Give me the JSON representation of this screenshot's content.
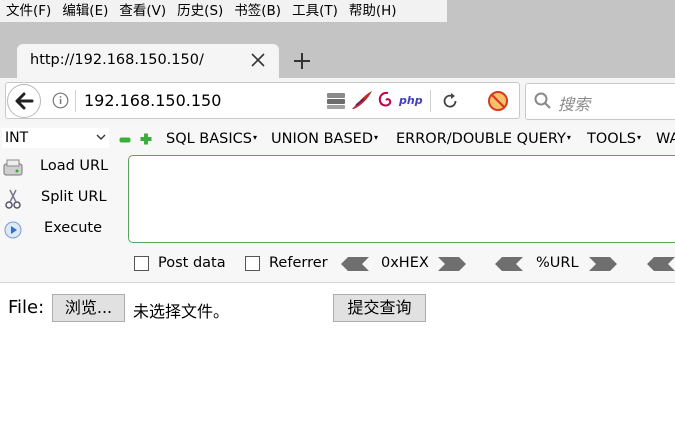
{
  "menubar": {
    "items": [
      "文件(F)",
      "编辑(E)",
      "查看(V)",
      "历史(S)",
      "书签(B)",
      "工具(T)",
      "帮助(H)"
    ]
  },
  "tab": {
    "title": "http://192.168.150.150/"
  },
  "navbar": {
    "url": "192.168.150.150",
    "search_placeholder": "搜索",
    "php_badge": "php"
  },
  "hackbar": {
    "encoding_select": "INT",
    "menus": [
      "SQL BASICS",
      "UNION BASED",
      "ERROR/DOUBLE QUERY",
      "TOOLS",
      "WAF"
    ],
    "load_url": "Load URL",
    "split_url": "Split URL",
    "execute": "Execute",
    "post_data": "Post data",
    "referrer": "Referrer",
    "hex_label": "0xHEX",
    "url_label": "%URL",
    "colors": {
      "green": "#3cae3c",
      "textarea_border": "#5aa35a"
    }
  },
  "page": {
    "file_label": "File:",
    "browse_button": "浏览...",
    "no_file_text": "未选择文件。",
    "submit_button": "提交查询"
  }
}
